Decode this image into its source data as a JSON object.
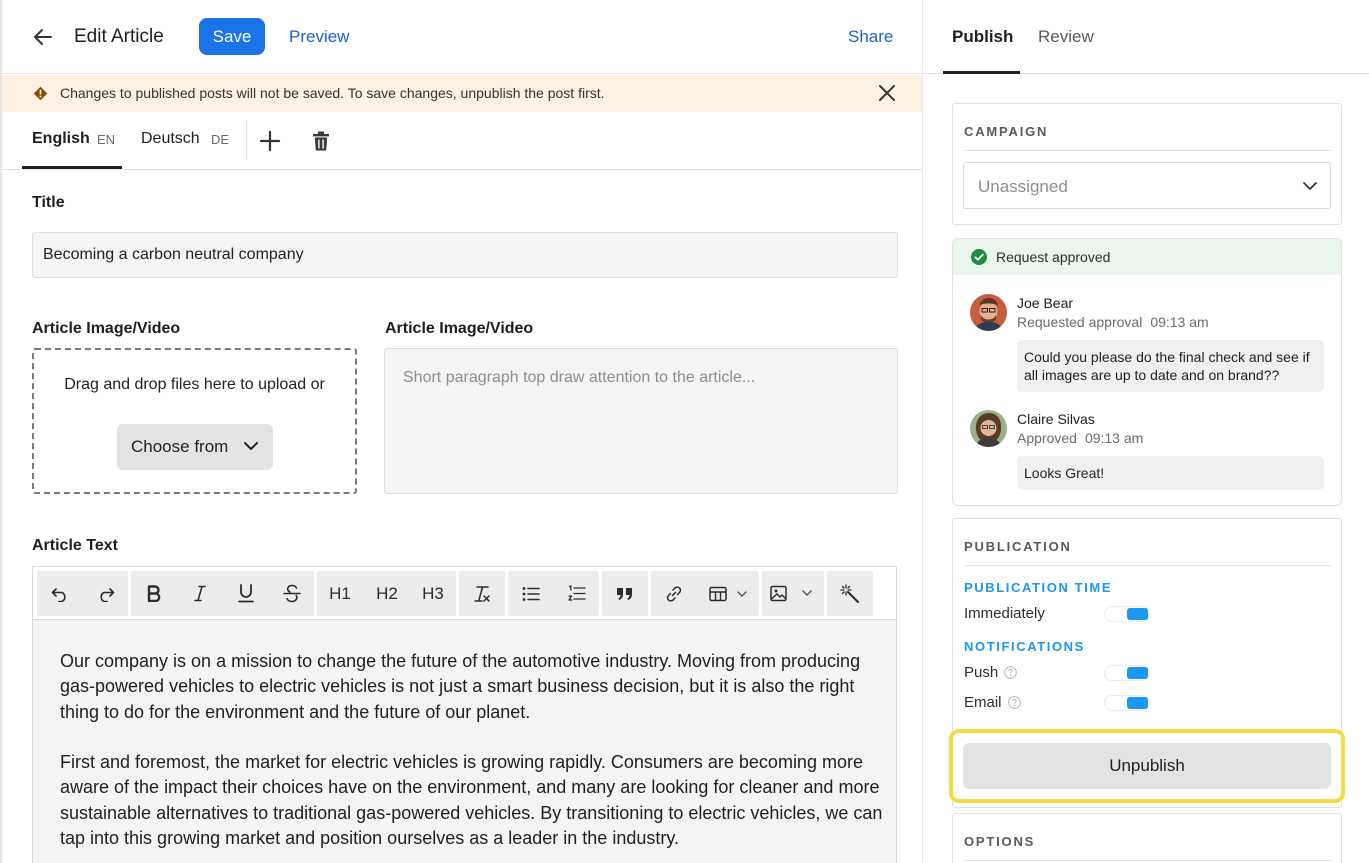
{
  "header": {
    "title": "Edit Article",
    "save_label": "Save",
    "preview_label": "Preview",
    "share_label": "Share"
  },
  "banner": {
    "icon": "warning-diamond-icon",
    "text": "Changes to published posts will not be saved. To save changes, unpublish the post first."
  },
  "languages": [
    {
      "name": "English",
      "code": "EN",
      "active": true
    },
    {
      "name": "Deutsch",
      "code": "DE",
      "active": false
    }
  ],
  "form": {
    "title_label": "Title",
    "title_value": "Becoming a carbon neutral company",
    "media_label": "Article Image/Video",
    "dropzone_text": "Drag and drop files here to upload or",
    "choose_label": "Choose from",
    "summary_label": "Article Image/Video",
    "summary_placeholder": "Short paragraph top draw attention to the article...",
    "text_label": "Article Text"
  },
  "toolbar": {
    "h1": "H1",
    "h2": "H2",
    "h3": "H3",
    "icons": [
      "undo-icon",
      "redo-icon",
      "bold-icon",
      "italic-icon",
      "underline-icon",
      "strikethrough-icon",
      "clear-format-icon",
      "bullet-list-icon",
      "numbered-list-icon",
      "quote-icon",
      "link-icon",
      "table-icon",
      "image-icon",
      "magic-wand-icon"
    ]
  },
  "editor": {
    "paragraphs": [
      "Our company is on a mission to change the future of the automotive industry. Moving from producing gas-powered vehicles to electric vehicles is not just a smart business decision, but it is also the right thing to do for the environment and the future of our planet.",
      "First and foremost, the market for electric vehicles is growing rapidly. Consumers are becoming more aware of the impact their choices have on the environment, and many are looking for cleaner and more sustainable alternatives to traditional gas-powered vehicles. By transitioning to electric vehicles, we can tap into this growing market and position ourselves as a leader in the industry."
    ]
  },
  "right_tabs": [
    {
      "label": "Publish",
      "active": true
    },
    {
      "label": "Review",
      "active": false
    }
  ],
  "campaign": {
    "heading": "CAMPAIGN",
    "value": "Unassigned"
  },
  "approval": {
    "status": "Request approved",
    "comments": [
      {
        "name": "Joe Bear",
        "action": "Requested approval",
        "time": "09:13 am",
        "message": "Could you please do the final check and see if all images are up to date and on brand??"
      },
      {
        "name": "Claire Silvas",
        "action": "Approved",
        "time": "09:13 am",
        "message": "Looks Great!"
      }
    ]
  },
  "publication": {
    "heading": "PUBLICATION",
    "time_heading": "PUBLICATION TIME",
    "immediately_label": "Immediately",
    "immediately_on": true,
    "notifications_heading": "NOTIFICATIONS",
    "push_label": "Push",
    "push_on": true,
    "email_label": "Email",
    "email_on": true,
    "unpublish_label": "Unpublish"
  },
  "options": {
    "heading": "OPTIONS"
  },
  "colors": {
    "accent": "#1a73e8",
    "toggle_on": "#1a97f0",
    "banner_bg": "#fdf1e3",
    "approved_bg": "#eaf6ec",
    "highlight": "#f5db3d"
  }
}
